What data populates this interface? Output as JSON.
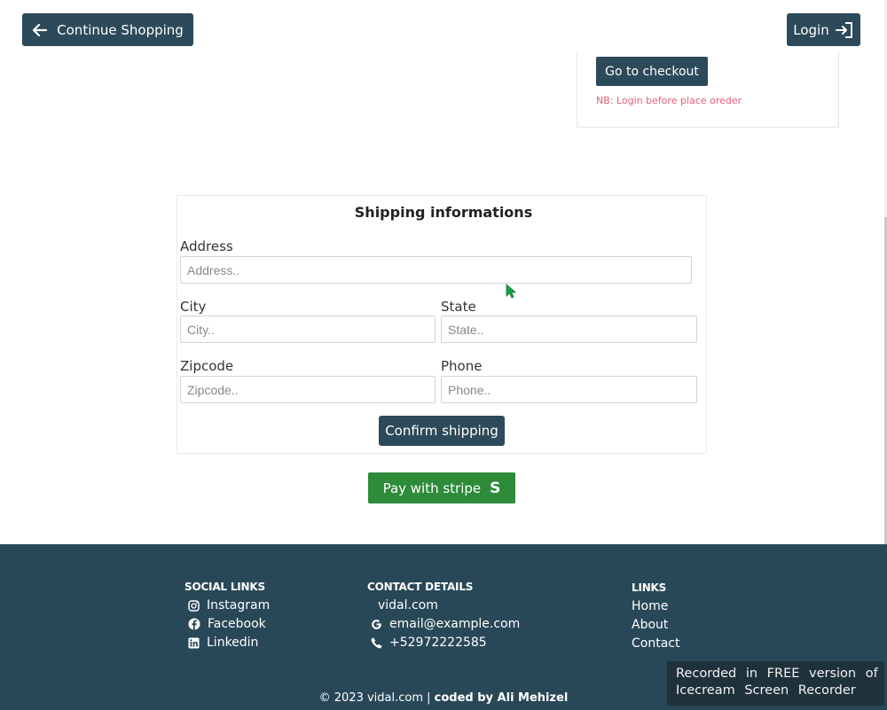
{
  "header": {
    "continue_label": "Continue Shopping",
    "login_label": "Login"
  },
  "cart": {
    "checkout_label": "Go to checkout",
    "note": "NB: Login before place oreder"
  },
  "shipping": {
    "title": "Shipping informations",
    "address_label": "Address",
    "address_placeholder": "Address..",
    "city_label": "City",
    "city_placeholder": "City..",
    "state_label": "State",
    "state_placeholder": "State..",
    "zipcode_label": "Zipcode",
    "zipcode_placeholder": "Zipcode..",
    "phone_label": "Phone",
    "phone_placeholder": "Phone..",
    "confirm_label": "Confirm shipping"
  },
  "payment": {
    "pay_label": "Pay with stripe",
    "pay_icon": "S"
  },
  "footer": {
    "social_heading": "SOCIAL LINKS",
    "social_items": [
      "Instagram",
      "Facebook",
      "Linkedin"
    ],
    "contact_heading": "CONTACT DETAILS",
    "contact_items": [
      "vidal.com",
      "email@example.com",
      "+52972222585"
    ],
    "links_heading": "LINKS",
    "links_items": [
      "Home",
      "About",
      "Contact"
    ],
    "copyright": "© 2023 vidal.com | ",
    "coded_by": "coded by Ali Mehizel"
  },
  "watermark": {
    "line1": "Recorded in FREE version of",
    "line2": "Icecream Screen Recorder"
  },
  "colors": {
    "primary_dark": "#2c4a5a",
    "footer_bg": "#284858",
    "stripe_green": "#2e8b3a",
    "note_pink": "#e0607a"
  }
}
